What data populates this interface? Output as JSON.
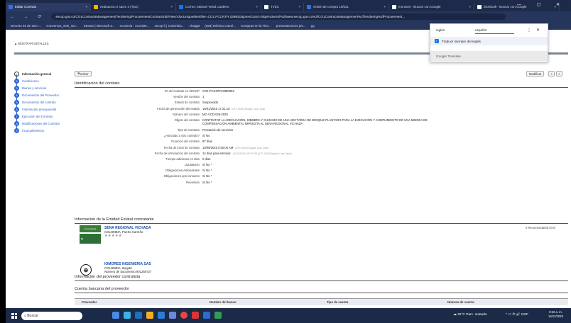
{
  "browser": {
    "tabs": [
      {
        "label": "Editar Contrato",
        "color": "#3b6ee0",
        "active": true
      },
      {
        "label": "evaluacion 2 sacm 3 (Tipo)",
        "color": "#f4b400",
        "active": false
      },
      {
        "label": "Correo: Manuel Yesid Cardeno",
        "color": "#1a73e8",
        "active": false
      },
      {
        "label": "TVEC",
        "color": "#ffffff",
        "active": false
      },
      {
        "label": "Orden de compra 15/021",
        "color": "#3b6ee0",
        "active": false
      },
      {
        "label": "monsum - Buscar con Google",
        "color": "#ffffff",
        "active": false
      },
      {
        "label": "facebook - Buscar con Google",
        "color": "#ffffff",
        "active": false
      }
    ],
    "url": "secop.gov.co/CO1ContractsManagement/Tendering/ProcurementContractEdit/View?docUniqueIdentifier=CO1.PCCNTR.03993G&prevCtxUrl=https%3a%2f%2fwww.secop.gov.co%2fCO1ContractsManagement%2fTendering%2fProcurement...",
    "bookmarks": [
      "Decreto 92 de 2017...",
      "Convenios_web_sec...",
      "Stream | Microsoft 3...",
      "ecosesia - ecosiste...",
      "secop-ii | Colombia...",
      "chatgpt",
      "(593) Mínima cuantí...",
      "Compras en la Tien...",
      "presentaciones p/o...",
      "pg"
    ]
  },
  "translate_popup": {
    "lang_from": "inglés",
    "lang_to": "español",
    "checkbox_label": "Traducir siempre del inglés",
    "footer": "Google Translate"
  },
  "page": {
    "show_details": "MOSTRAR DETALLES",
    "back_button": "Volver",
    "modify_button": "Modificar",
    "prev_arrow": "<",
    "next_arrow": ">",
    "steps": [
      {
        "num": "1",
        "label": "Información general"
      },
      {
        "num": "2",
        "label": "Condiciones"
      },
      {
        "num": "3",
        "label": "Bienes y servicios"
      },
      {
        "num": "4",
        "label": "Documentos del Proveedor"
      },
      {
        "num": "5",
        "label": "Documentos del contrato"
      },
      {
        "num": "6",
        "label": "Información presupuestal"
      },
      {
        "num": "7",
        "label": "Ejecución del Contrato"
      },
      {
        "num": "8",
        "label": "Modificaciones del Contrato"
      },
      {
        "num": "9",
        "label": "Incumplimientos"
      }
    ],
    "section_contract": "Identificación del contrato",
    "fields": [
      {
        "label": "ID del contrato en SECOP",
        "value": "CO1.PCCNTR.8380062",
        "hint": ""
      },
      {
        "label": "Versión del contrato",
        "value": "1",
        "hint": ""
      },
      {
        "label": "Estado de contrato",
        "value": "Suspendido",
        "hint": ""
      },
      {
        "label": "Fecha de generación del estado",
        "value": "16/01/2025 17:21:15",
        "hint": "(UTC-05:00) Bogotá, Lima, Quito"
      },
      {
        "label": "Número del contrato",
        "value": "MC-VCD-026-2025",
        "hint": ""
      },
      {
        "label": "Objeto del contrato",
        "value": "CONTRATAR LA ADECUACIÓN, SIEMBRA Y CUIDADO DE UNA HECTÁREA DE BOSQUE PLANTADO PARA LA EJECUCIÓN Y CUMPLIMIENTO DE UNA MEDIDA DE COMPENSACIÓN AMBIENTAL IMPUESTA AL SENA REGIONAL VICHADA",
        "hint": ""
      },
      {
        "label": "Tipo de Contrato",
        "value": "Prestación de servicios",
        "hint": ""
      },
      {
        "label": "¿Asociado a otro contrato?",
        "value": "Sí   No",
        "hint": ""
      },
      {
        "label": "Duración del contrato",
        "value": "87  días",
        "hint": ""
      },
      {
        "label": "Fecha de inicio de contrato",
        "value": "10/09/2025 0:00:00 AM",
        "hint": "(UTC-05:00) Bogotá, Lima, Quito"
      },
      {
        "label": "Fecha de terminación del contrato",
        "value": "14 días para terminar",
        "hint": "(30/12/2025 0:00:00 PM (UTC-05:00) Bogotá, Lima, Quito)"
      },
      {
        "label": "Tiempo adiciones en días",
        "value": "0 días",
        "hint": ""
      },
      {
        "label": "Liquidación",
        "value": "Sí   No *",
        "hint": ""
      },
      {
        "label": "Obligaciones Ambientales",
        "value": "Sí   No *",
        "hint": ""
      },
      {
        "label": "Obligaciones pos consumo",
        "value": "Sí   No *",
        "hint": ""
      },
      {
        "label": "Reversión",
        "value": "Sí   No *",
        "hint": ""
      }
    ],
    "section_entity": "Información de la Entidad Estatal contratante",
    "entity": {
      "name": "SENA REGIONAL VICHADA",
      "location": "COLOMBIA, Puerto Carreño",
      "stars": "★★★★★",
      "logo_text": "Compradora",
      "recommend": "0 Recomendación (es)"
    },
    "section_provider": "Información del proveedor contratista",
    "provider": {
      "name": "IOMORES INGENIERIA SAS",
      "location": "COLOMBIA, Bogotá",
      "doc": "Número de documento 901250727"
    },
    "section_bank": "Cuenta bancaria del proveedor",
    "bank_headers": [
      "Proveedor",
      "Nombre del banco",
      "Tipo de cuenta",
      "Número de cuenta"
    ]
  },
  "taskbar": {
    "search": "Buscar",
    "weather": "32°C  Parc. soleado",
    "tray": "ESP",
    "time": "9:22 a. m.",
    "date": "16/12/2025"
  }
}
